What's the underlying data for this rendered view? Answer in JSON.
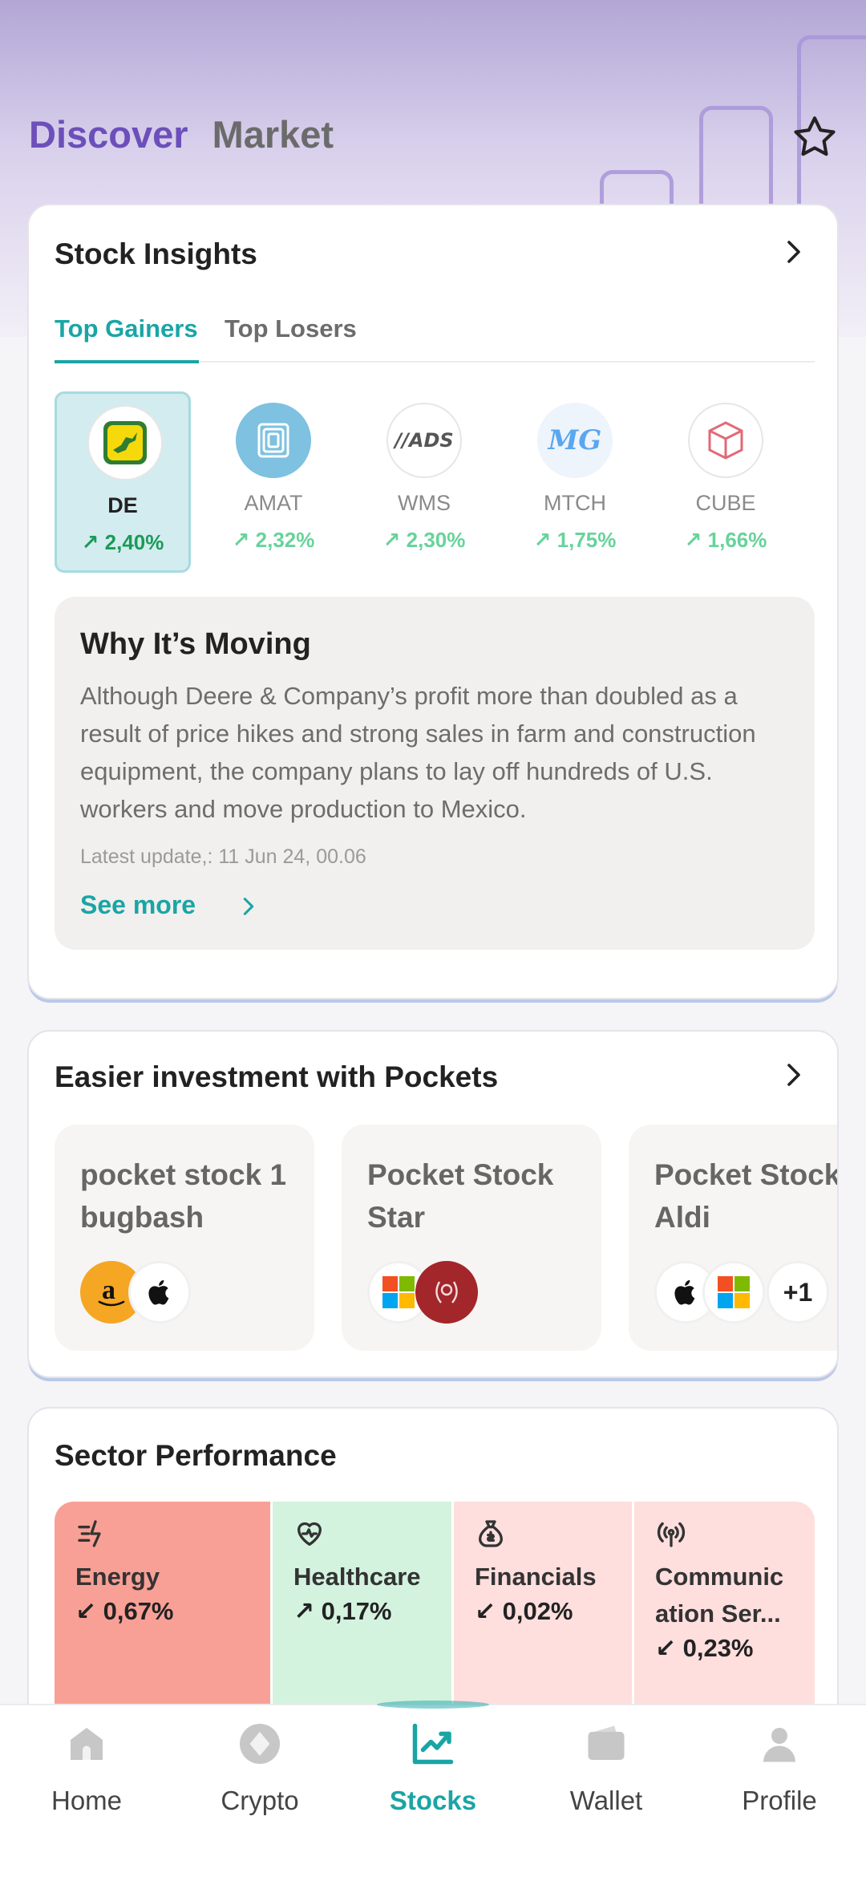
{
  "header": {
    "tabs": [
      "Discover",
      "Market"
    ]
  },
  "insights": {
    "title": "Stock Insights",
    "tabs": [
      "Top Gainers",
      "Top Losers"
    ],
    "gainers": [
      {
        "symbol": "DE",
        "change": "2,40%"
      },
      {
        "symbol": "AMAT",
        "change": "2,32%"
      },
      {
        "symbol": "WMS",
        "change": "2,30%"
      },
      {
        "symbol": "MTCH",
        "change": "1,75%"
      },
      {
        "symbol": "CUBE",
        "change": "1,66%"
      }
    ],
    "why": {
      "title": "Why It’s Moving",
      "body": "Although Deere & Company’s profit more than doubled as a result of price hikes and strong sales in farm and construction equipment, the company plans to lay off hundreds of U.S. workers and move production to Mexico.",
      "updated": "Latest update,: 11 Jun 24, 00.06",
      "see_more": "See more"
    },
    "logo_texts": {
      "wms": "//ADS",
      "mtch": "MG"
    }
  },
  "pockets": {
    "title": "Easier investment with Pockets",
    "items": [
      {
        "name": "pocket stock 1 bugbash"
      },
      {
        "name": "Pocket Stock Star"
      },
      {
        "name": "Pocket Stock Aldi",
        "more": "+1"
      }
    ]
  },
  "sectors": {
    "title": "Sector Performance",
    "items": [
      {
        "name": "Energy",
        "change": "0,67%",
        "color": "#f9a096",
        "icon": "bolt-icon"
      },
      {
        "name": "Healthcare",
        "change": "0,17%",
        "color": "#d3f3df",
        "icon": "heart-pulse-icon"
      },
      {
        "name": "Financials",
        "change": "0,02%",
        "color": "#ffdede",
        "icon": "money-bag-icon"
      },
      {
        "name": "Communic ation Ser...",
        "change": "0,23%",
        "color": "#ffdede",
        "icon": "broadcast-icon"
      }
    ]
  },
  "nav": {
    "items": [
      "Home",
      "Crypto",
      "Stocks",
      "Wallet",
      "Profile"
    ],
    "active": "Stocks"
  },
  "colors": {
    "accent": "#1aa5a5",
    "brand": "#6c4fba",
    "gain": "#1a9b57"
  }
}
